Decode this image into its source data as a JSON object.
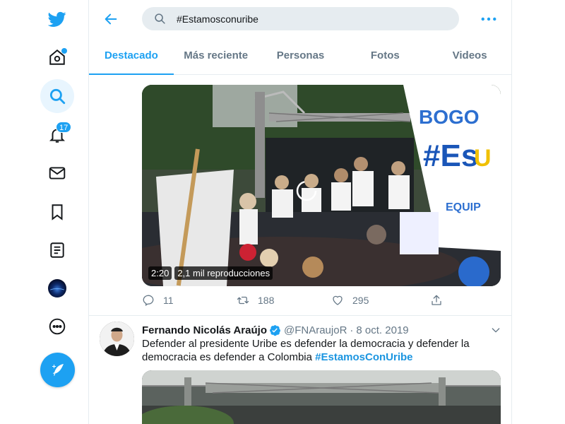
{
  "search": {
    "value": "#Estamosconuribe"
  },
  "tabs": [
    {
      "label": "Destacado",
      "active": true
    },
    {
      "label": "Más reciente",
      "active": false
    },
    {
      "label": "Personas",
      "active": false
    },
    {
      "label": "Fotos",
      "active": false
    },
    {
      "label": "Videos",
      "active": false
    }
  ],
  "nav": {
    "notifications_badge": "17",
    "items": [
      "twitter-logo",
      "home",
      "explore",
      "notifications",
      "messages",
      "bookmarks",
      "lists",
      "profile",
      "more"
    ],
    "accent": "#1da1f2"
  },
  "video": {
    "duration": "2:20",
    "views": "2,1 mil reproducciones"
  },
  "first_tweet_actions": {
    "replies": "11",
    "retweets": "188",
    "likes": "295"
  },
  "second_tweet": {
    "name": "Fernando Nicolás Araújo",
    "handle": "@FNAraujoR",
    "separator": "·",
    "date": "8 oct. 2019",
    "text": "Defender al presidente Uribe es defender la democracia y defender la democracia es defender a Colombia ",
    "hashtag": "#EstamosConUribe"
  }
}
